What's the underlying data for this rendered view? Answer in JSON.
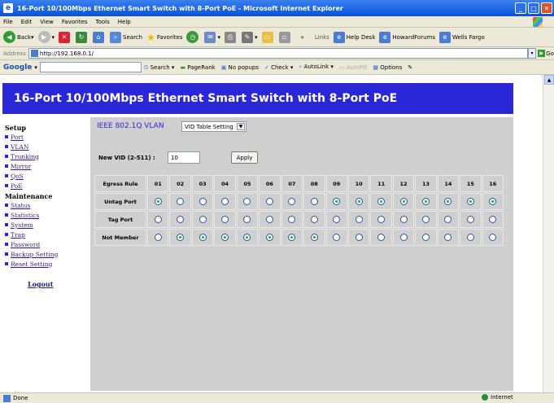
{
  "window": {
    "title": "16-Port 10/100Mbps Ethernet Smart Switch with 8-Port PoE - Microsoft Internet Explorer"
  },
  "menu": [
    "File",
    "Edit",
    "View",
    "Favorites",
    "Tools",
    "Help"
  ],
  "toolbar": {
    "back": "Back",
    "search": "Search",
    "favorites": "Favorites",
    "links_label": "Links",
    "link1": "Help Desk",
    "link2": "HowardForums",
    "link3": "Wells Fargo"
  },
  "address": {
    "label": "Address",
    "url": "http://192.168.0.1/",
    "go": "Go"
  },
  "googlebar": {
    "brand": "Google",
    "search": "Search",
    "pagerank": "PageRank",
    "popups": "No popups",
    "check": "Check",
    "autolink": "AutoLink",
    "autofill": "AutoFill",
    "options": "Options"
  },
  "page": {
    "banner": "16-Port 10/100Mbps Ethernet Smart Switch with 8-Port PoE"
  },
  "sidebar": {
    "setup_heading": "Setup",
    "setup_links": [
      "Port",
      "VLAN",
      "Trunking",
      "Mirror",
      "QoS",
      "PoE"
    ],
    "maint_heading": "Maintenance",
    "maint_links": [
      "Status",
      "Statistics",
      "System",
      "Trap",
      "Password",
      "Backup Setting",
      "Reset Setting"
    ],
    "logout": "Logout"
  },
  "vlan": {
    "title": "IEEE 802.1Q VLAN",
    "mode": "VID Table Setting",
    "vid_label": "New VID  (2-511) :",
    "vid_value": "10",
    "apply": "Apply",
    "table": {
      "header_label": "Egress Rule",
      "ports": [
        "01",
        "02",
        "03",
        "04",
        "05",
        "06",
        "07",
        "08",
        "09",
        "10",
        "11",
        "12",
        "13",
        "14",
        "15",
        "16"
      ],
      "rows": [
        {
          "label": "Untag Port",
          "selected": [
            1,
            0,
            0,
            0,
            0,
            0,
            0,
            0,
            1,
            1,
            1,
            1,
            1,
            1,
            1,
            1
          ]
        },
        {
          "label": "Tag Port",
          "selected": [
            0,
            0,
            0,
            0,
            0,
            0,
            0,
            0,
            0,
            0,
            0,
            0,
            0,
            0,
            0,
            0
          ]
        },
        {
          "label": "Not Member",
          "selected": [
            0,
            1,
            1,
            1,
            1,
            1,
            1,
            1,
            0,
            0,
            0,
            0,
            0,
            0,
            0,
            0
          ]
        }
      ]
    }
  },
  "status": {
    "left": "Done",
    "zone": "Internet"
  }
}
